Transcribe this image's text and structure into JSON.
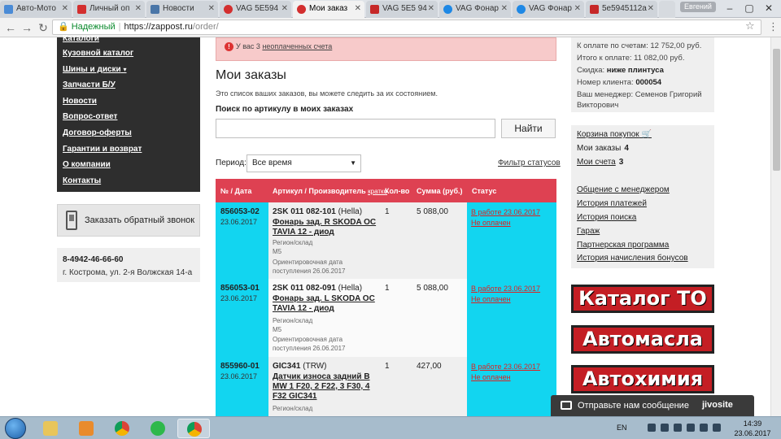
{
  "browser": {
    "tabs": [
      {
        "title": "Авто-Мото",
        "icon_color": "#4a8bd6",
        "active": false
      },
      {
        "title": "Личный оп",
        "icon_color": "#d32f2f",
        "active": false
      },
      {
        "title": "Новости",
        "icon_color": "#4a76a8",
        "active": false
      },
      {
        "title": "VAG 5E594",
        "icon_color": "#d32f2f",
        "active": false
      },
      {
        "title": "Мои заказ",
        "icon_color": "#d32f2f",
        "active": true
      },
      {
        "title": "VAG 5E5 94",
        "icon_color": "#c62828",
        "active": false
      },
      {
        "title": "VAG Фонар",
        "icon_color": "#1e88e5",
        "active": false
      },
      {
        "title": "VAG Фонар",
        "icon_color": "#1e88e5",
        "active": false
      },
      {
        "title": "5e5945112a",
        "icon_color": "#c62828",
        "active": false
      }
    ],
    "user_badge": "Евгений",
    "secure_label": "Надежный",
    "url_host": "https://zappost.ru",
    "url_path": "/order/"
  },
  "sidebar": {
    "items": [
      {
        "label": "Каталоги"
      },
      {
        "label": "Кузовной каталог"
      },
      {
        "label": "Шины и диски"
      },
      {
        "label": "Запчасти Б/У"
      },
      {
        "label": "Новости"
      },
      {
        "label": "Вопрос-ответ"
      },
      {
        "label": "Договор-оферты"
      },
      {
        "label": "Гарантии и возврат"
      },
      {
        "label": "О компании"
      },
      {
        "label": "Контакты"
      }
    ],
    "callback_label": "Заказать обратный звонок",
    "phone": "8-4942-46-66-60",
    "address": "г. Кострома, ул. 2-я Волжская 14-а"
  },
  "alert": {
    "prefix": "У вас 3",
    "link": "неоплаченных счета"
  },
  "main": {
    "title": "Мои заказы",
    "intro": "Это список ваших заказов, вы можете следить за их состоянием.",
    "search_label": "Поиск по артикулу в моих заказах",
    "search_value": "",
    "find_button": "Найти",
    "period_label": "Период:",
    "period_value": "Все время",
    "filter_link": "Фильтр статусов"
  },
  "table": {
    "headers": {
      "num": "№ / Дата",
      "article": "Артикул / Производитель",
      "article_small": "кратко",
      "qty": "Кол-во",
      "sum": "Сумма (руб.)",
      "status": "Статус"
    },
    "rows": [
      {
        "id": "856053-02",
        "date": "23.06.2017",
        "article": "2SK 011 082-101",
        "maker": "(Hella)",
        "name": "Фонарь зад. R SKODA OC TAVIA 12 - диод",
        "meta1": "Регион/склад",
        "meta2": "M5",
        "meta3": "Ориентировочная дата поступления 26.06.2017",
        "qty": "1",
        "sum": "5 088,00",
        "status1": "В работе 23.06.2017",
        "status2": "Не оплачен"
      },
      {
        "id": "856053-01",
        "date": "23.06.2017",
        "article": "2SK 011 082-091",
        "maker": "(Hella)",
        "name": "Фонарь зад. L SKODA OC TAVIA 12 - диод",
        "meta1": "Регион/склад",
        "meta2": "M5",
        "meta3": "Ориентировочная дата поступления 26.06.2017",
        "qty": "1",
        "sum": "5 088,00",
        "status1": "В работе 23.06.2017",
        "status2": "Не оплачен"
      },
      {
        "id": "855960-01",
        "date": "23.06.2017",
        "article": "GIC341",
        "maker": "(TRW)",
        "name": "Датчик износа задний B MW 1 F20, 2 F22, 3 F30, 4 F32 GIC341",
        "meta1": "Регион/склад",
        "meta2": "",
        "meta3": "",
        "qty": "1",
        "sum": "427,00",
        "status1": "В работе 23.06.2017",
        "status2": "Не оплачен"
      }
    ]
  },
  "summary": {
    "to_pay_invoices": "К оплате по счетам: 12 752,00 руб.",
    "total_to_pay": "Итого к оплате: 11 082,00 руб.",
    "discount_label": "Скидка:",
    "discount_value": "ниже плинтуса",
    "client_label": "Номер клиента:",
    "client_value": "000054",
    "manager": "Ваш менеджер: Семенов Григорий Викторович"
  },
  "account": {
    "cart": "Корзина покупок",
    "orders_label": "Мои заказы",
    "orders_count": "4",
    "invoices_label": "Мои счета",
    "invoices_count": "3",
    "links": [
      "Общение с менеджером",
      "История платежей",
      "История поиска",
      "Гараж",
      "Партнерская программа",
      "История начисления бонусов"
    ]
  },
  "promos": [
    "Каталог ТО",
    "Автомасла",
    "Автохимия"
  ],
  "chat": {
    "message": "Отправьте нам сообщение",
    "brand": "jivosite"
  },
  "taskbar": {
    "lang": "EN",
    "time": "14:39",
    "date": "23.06.2017"
  },
  "colors": {
    "accent_red": "#de4152",
    "row_cyan": "#12d5f0",
    "status_red": "#d22222",
    "sidebar_dark": "#2e2e2e"
  }
}
